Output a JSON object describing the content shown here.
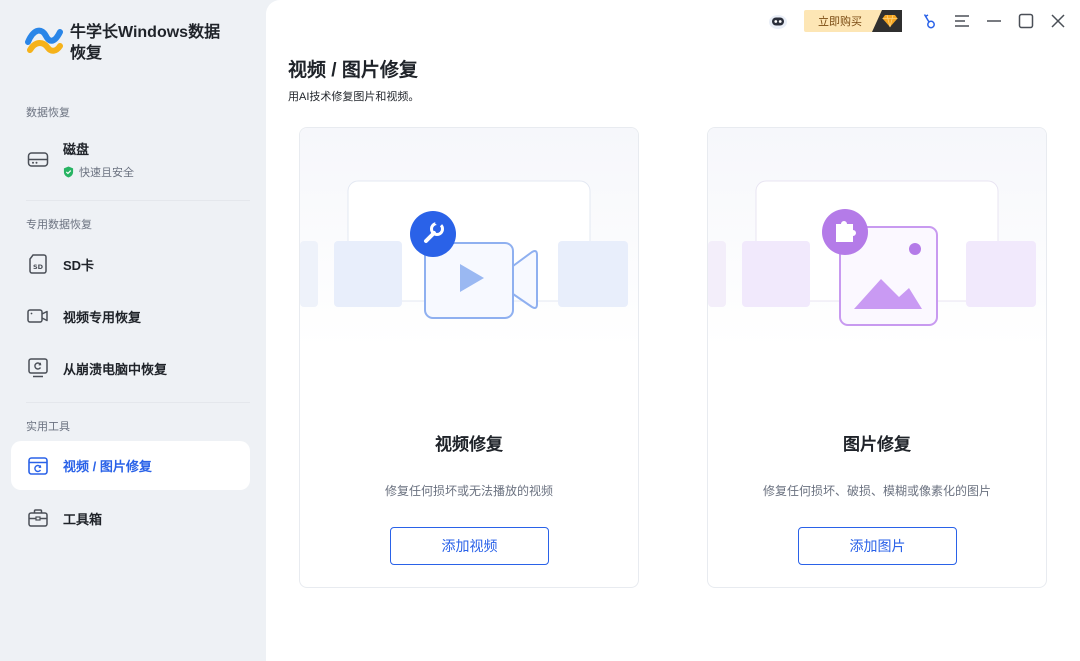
{
  "app": {
    "name": "牛学长Windows数据恢复"
  },
  "sidebar": {
    "sections": [
      {
        "label": "数据恢复"
      },
      {
        "label": "专用数据恢复"
      },
      {
        "label": "实用工具"
      }
    ],
    "items": [
      {
        "label": "磁盘",
        "sub": "快速且安全",
        "icon": "hard-drive-icon"
      },
      {
        "label": "SD卡",
        "icon": "sd-card-icon"
      },
      {
        "label": "视频专用恢复",
        "icon": "video-camera-icon"
      },
      {
        "label": "从崩溃电脑中恢复",
        "icon": "crashed-computer-icon"
      },
      {
        "label": "视频 / 图片修复",
        "icon": "repair-icon",
        "active": true
      },
      {
        "label": "工具箱",
        "icon": "toolbox-icon"
      }
    ]
  },
  "titlebar": {
    "buy_label": "立即购买",
    "icons": [
      "robot-icon",
      "diamond-icon",
      "key-icon",
      "menu-icon",
      "minimize-icon",
      "maximize-icon",
      "close-icon"
    ]
  },
  "page": {
    "title": "视频 / 图片修复",
    "subtitle": "用AI技术修复图片和视频。"
  },
  "cards": [
    {
      "title": "视频修复",
      "desc": "修复任何损坏或无法播放的视频",
      "button": "添加视频"
    },
    {
      "title": "图片修复",
      "desc": "修复任何损坏、破损、模糊或像素化的图片",
      "button": "添加图片"
    }
  ],
  "colors": {
    "accent": "#2a62e8",
    "sidebar_bg": "#eef1f5",
    "buy_bg": "#fde6b5",
    "video_icon": "#8fb0f0",
    "image_icon": "#b47be8"
  }
}
